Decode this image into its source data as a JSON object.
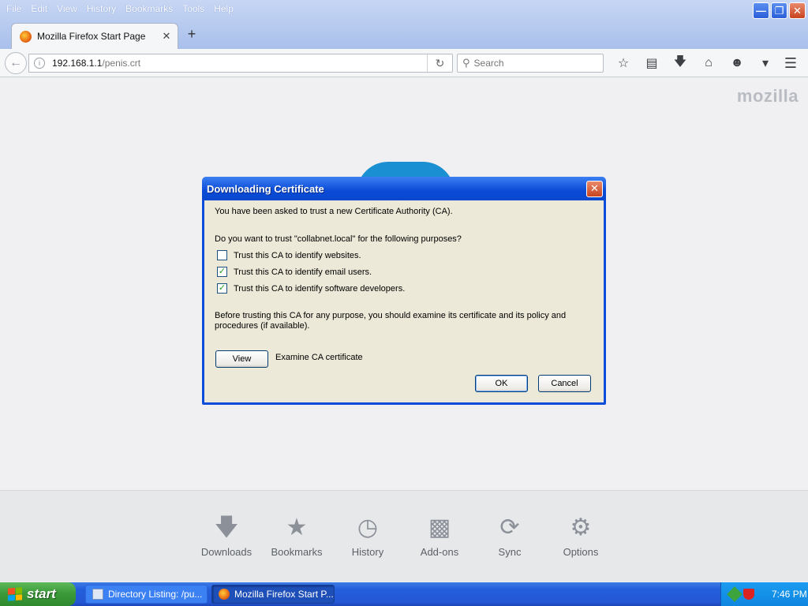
{
  "browser": {
    "menu": [
      {
        "label": "File"
      },
      {
        "label": "Edit"
      },
      {
        "label": "View"
      },
      {
        "label": "History"
      },
      {
        "label": "Bookmarks"
      },
      {
        "label": "Tools"
      },
      {
        "label": "Help"
      }
    ],
    "tab": {
      "title": "Mozilla Firefox Start Page"
    },
    "url": {
      "host": "192.168.1.1",
      "path": "/penis.crt"
    },
    "search": {
      "placeholder": "Search"
    },
    "toolbar_icons": [
      "star-bookmark-icon",
      "reading-list-icon",
      "download-arrow-icon",
      "home-icon",
      "smiley-feedback-icon",
      "pocket-icon"
    ]
  },
  "page": {
    "logo": "mozilla",
    "launcher": [
      {
        "label": "Downloads",
        "icon": "download-icon"
      },
      {
        "label": "Bookmarks",
        "icon": "star-icon"
      },
      {
        "label": "History",
        "icon": "clock-icon"
      },
      {
        "label": "Add-ons",
        "icon": "puzzle-icon"
      },
      {
        "label": "Sync",
        "icon": "sync-icon"
      },
      {
        "label": "Options",
        "icon": "gear-icon"
      }
    ]
  },
  "dialog": {
    "title": "Downloading Certificate",
    "intro": "You have been asked to trust a new Certificate Authority (CA).",
    "question": "Do you want to trust \"collabnet.local\" for the following purposes?",
    "options": [
      {
        "label": "Trust this CA to identify websites.",
        "checked": false
      },
      {
        "label": "Trust this CA to identify email users.",
        "checked": true
      },
      {
        "label": "Trust this CA to identify software developers.",
        "checked": true
      }
    ],
    "advice": "Before trusting this CA for any purpose, you should examine its certificate and its policy and procedures (if available).",
    "view_button": "View",
    "view_caption": "Examine CA certificate",
    "ok_button": "OK",
    "cancel_button": "Cancel"
  },
  "taskbar": {
    "start_label": "start",
    "tasks": [
      {
        "label": "Directory Listing: /pu..."
      },
      {
        "label": "Mozilla Firefox Start P..."
      }
    ],
    "clock": "7:46 PM"
  },
  "colors": {
    "xp_blue": "#0a4ddb",
    "dialog_face": "#ece9d8",
    "start_green": "#3c9a3a",
    "firefox_chrome": "#f5f6f7"
  }
}
